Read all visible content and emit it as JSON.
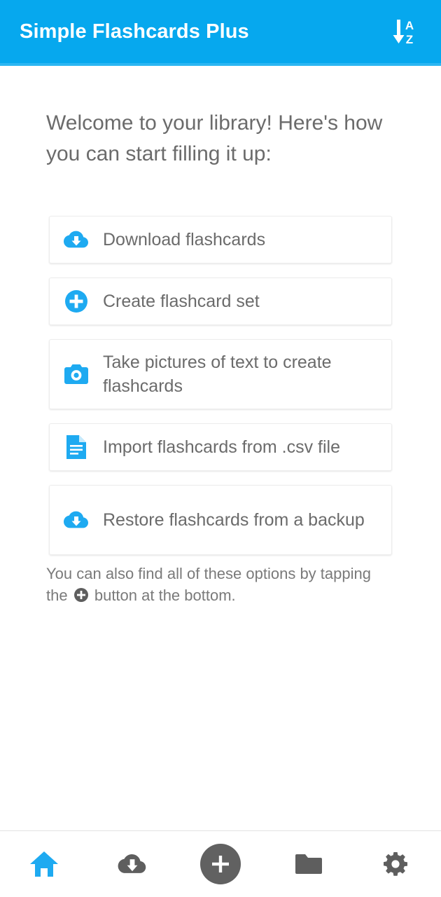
{
  "appbar": {
    "title": "Simple Flashcards Plus",
    "sort_icon": "sort-alpha-down-icon",
    "background_color": "#06a8ee",
    "title_color": "#ffffff"
  },
  "main": {
    "welcome_heading": "Welcome to your library! Here's how you can start filling it up:",
    "accent_color": "#1eaaf1",
    "text_color": "#6b6b6b",
    "options": [
      {
        "label": "Download flashcards",
        "icon": "cloud-download-icon"
      },
      {
        "label": "Create flashcard set",
        "icon": "plus-circle-icon"
      },
      {
        "label": "Take pictures of text to create flashcards",
        "icon": "camera-icon"
      },
      {
        "label": "Import flashcards from .csv file",
        "icon": "file-document-icon"
      },
      {
        "label": "Restore flashcards from a backup",
        "icon": "cloud-download-icon"
      }
    ],
    "footnote_before": "You can also find all of these options by tapping the",
    "footnote_icon": "plus-circle-filled-icon",
    "footnote_after": "button at the bottom."
  },
  "bottomnav": {
    "active_color": "#1eaaf1",
    "inactive_color": "#616161",
    "items": [
      {
        "name": "home",
        "icon": "home-icon",
        "active": true
      },
      {
        "name": "downloads",
        "icon": "cloud-download-icon",
        "active": false
      },
      {
        "name": "add",
        "icon": "plus-icon",
        "active": false
      },
      {
        "name": "folders",
        "icon": "folder-icon",
        "active": false
      },
      {
        "name": "settings",
        "icon": "gear-icon",
        "active": false
      }
    ]
  }
}
